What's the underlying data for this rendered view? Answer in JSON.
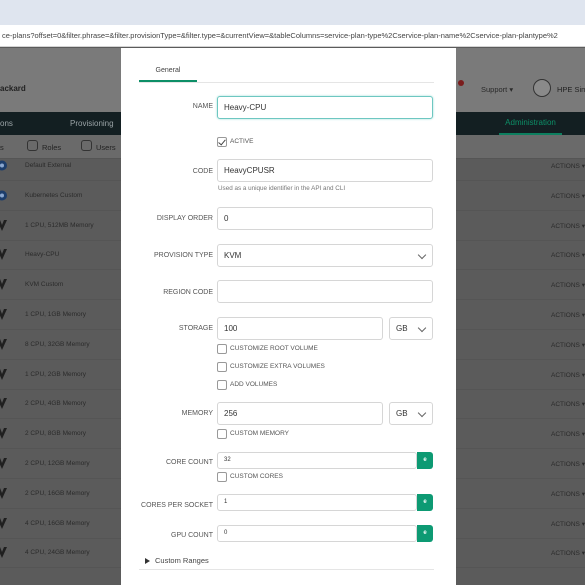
{
  "browser": {
    "url": "ce-plans?offset=0&filter.phrase=&filter.provisionType=&filter.type=&currentView=&tableColumns=service-plan-type%2Cservice-plan-name%2Cservice-plan-plantype%2"
  },
  "header": {
    "brand": "ackard",
    "support_label": "Support ▾",
    "user_name": "HPE Simp"
  },
  "nav": {
    "items": [
      "ons",
      "Provisioning"
    ],
    "admin_label": "Administration"
  },
  "subnav": {
    "items": [
      "s",
      "Roles",
      "Users"
    ]
  },
  "table": {
    "actions_label": "ACTIONS ▾",
    "rows": [
      "Default External",
      "Kubernetes Custom",
      "1 CPU, 512MB Memory",
      "Heavy-CPU",
      "KVM Custom",
      "1 CPU, 1GB Memory",
      "8 CPU, 32GB Memory",
      "1 CPU, 2GB Memory",
      "2 CPU, 4GB Memory",
      "2 CPU, 8GB Memory",
      "2 CPU, 12GB Memory",
      "2 CPU, 16GB Memory",
      "4 CPU, 16GB Memory",
      "4 CPU, 24GB Memory"
    ]
  },
  "modal": {
    "tab_general": "General",
    "name_label": "NAME",
    "name_value": "Heavy-CPU",
    "active_label": "ACTIVE",
    "active_checked": true,
    "code_label": "CODE",
    "code_value": "HeavyCPUSR",
    "code_hint": "Used as a unique identifier in the API and CLI",
    "display_order_label": "DISPLAY ORDER",
    "display_order_value": "0",
    "provision_type_label": "PROVISION TYPE",
    "provision_type_value": "KVM",
    "region_code_label": "REGION CODE",
    "region_code_value": "",
    "storage_label": "STORAGE",
    "storage_value": "100",
    "storage_unit": "GB",
    "customize_root_volume": "CUSTOMIZE ROOT VOLUME",
    "customize_extra_volumes": "CUSTOMIZE EXTRA VOLUMES",
    "add_volumes": "ADD VOLUMES",
    "memory_label": "MEMORY",
    "memory_value": "256",
    "memory_unit": "GB",
    "custom_memory": "CUSTOM MEMORY",
    "core_count_label": "CORE COUNT",
    "core_count_value": "32",
    "custom_cores": "CUSTOM CORES",
    "cores_per_socket_label": "CORES PER SOCKET",
    "cores_per_socket_value": "1",
    "gpu_count_label": "GPU COUNT",
    "gpu_count_value": "0",
    "stepper_button": "e",
    "custom_ranges": "Custom Ranges"
  },
  "colors": {
    "accent": "#0d8f67",
    "nav_bg": "#131f22",
    "overlay_bg": "#5b5b5b"
  }
}
